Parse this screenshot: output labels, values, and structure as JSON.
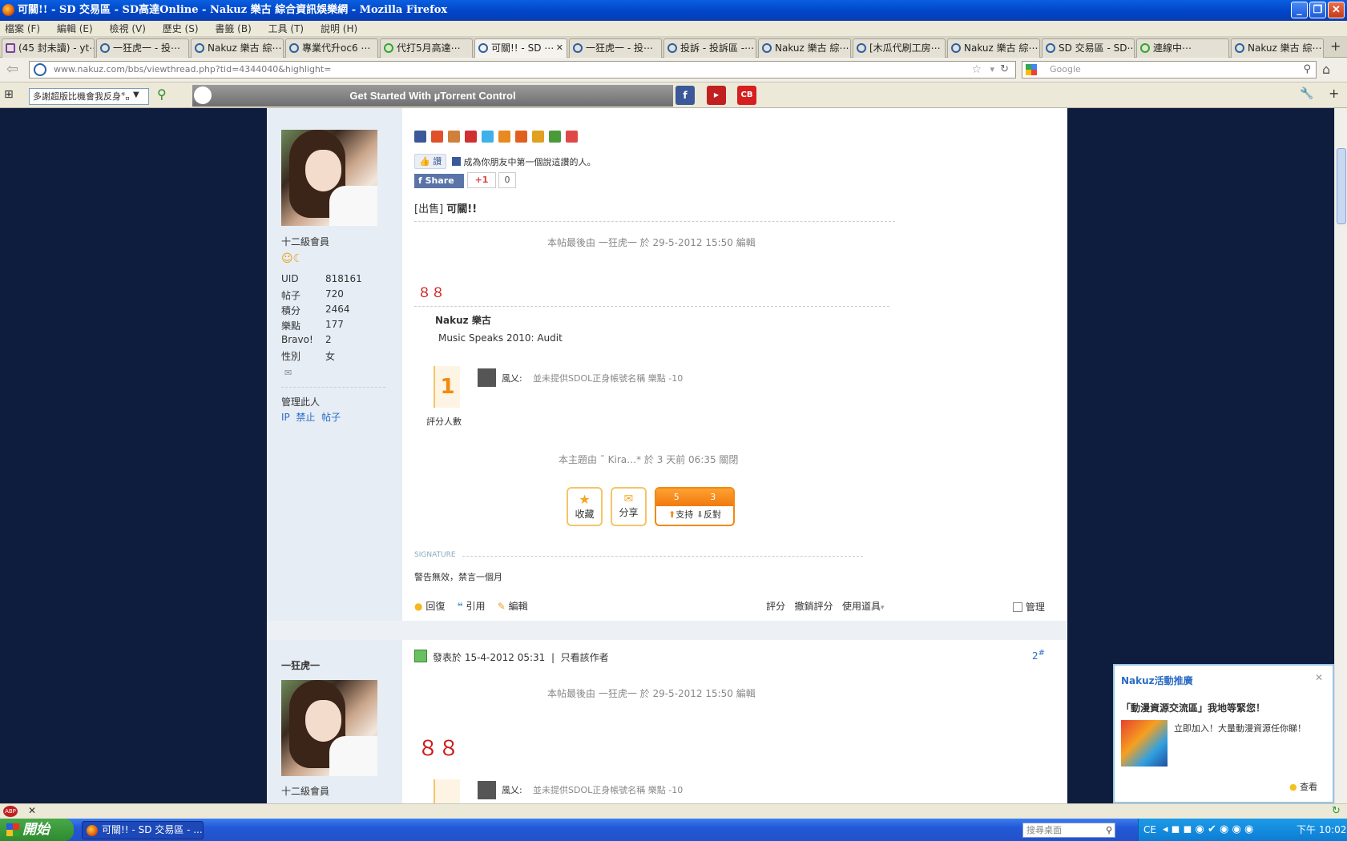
{
  "window": {
    "title": "可關!! - SD 交易區 - SD高達Online - Nakuz 樂古 綜合資訊娛樂網 - Mozilla Firefox"
  },
  "menu": [
    "檔案 (F)",
    "編輯 (E)",
    "檢視 (V)",
    "歷史 (S)",
    "書籤 (B)",
    "工具 (T)",
    "說明 (H)"
  ],
  "tabs": [
    "(45 封未讀) - yt⋯",
    "一狂虎一 - 投⋯",
    "Nakuz 樂古 綜⋯",
    "專業代升oc6 ⋯",
    "代打5月高達⋯",
    "可關!! - SD ⋯",
    "一狂虎一 - 投⋯",
    "投訴 - 投訴區 -⋯",
    "Nakuz 樂古 綜⋯",
    "[木瓜代刷工房⋯",
    "Nakuz 樂古 綜⋯",
    "SD 交易區 - SD⋯",
    "連線中⋯",
    "Nakuz 樂古 綜⋯"
  ],
  "url": "www.nakuz.com/bbs/viewthread.php?tid=4344040&highlight=",
  "search_placeholder": "Google",
  "toolbar": {
    "select_value": "多謝超版比機會我反身㌔",
    "utorrent": "Get Started With µTorrent Control"
  },
  "post1": {
    "rank": "十二級會員",
    "stats": [
      {
        "k": "UID",
        "v": "818161"
      },
      {
        "k": "帖子",
        "v": "720"
      },
      {
        "k": "積分",
        "v": "2464"
      },
      {
        "k": "樂點",
        "v": "177"
      },
      {
        "k": "Bravo!",
        "v": "2"
      },
      {
        "k": "性別",
        "v": "女"
      }
    ],
    "manage": "管理此人",
    "manage_links": [
      "IP",
      "禁止",
      "帖子"
    ],
    "like_btn": "讚",
    "like_text": "成為你朋友中第一個說這讚的人。",
    "share": "Share",
    "plus": "+1",
    "plus_count": "0",
    "tag": "[出售]",
    "title": "可關!!",
    "edited": "本帖最後由 一狂虎一 於 29-5-2012 15:50 編輯",
    "content": "８８",
    "rate_site": "Nakuz 樂古",
    "rate_event": "Music Speaks 2010: Audit",
    "rate_count": "1",
    "rate_label": "評分人數",
    "rater": "風乂:",
    "rate_reason": "並未提供SDOL正身帳號名稱 樂點 -10",
    "closed": "本主題由 ˜ Kira…* 於 3 天前 06:35 關閉",
    "fav": "收藏",
    "share_btn": "分享",
    "support_n": "5",
    "oppose_n": "3",
    "support": "支持",
    "oppose": "反對",
    "sig_label": "SIGNATURE",
    "signature": "警告無效，禁言一個月",
    "reply": "回復",
    "quote": "引用",
    "edit": "編輯",
    "rate": "評分",
    "unrate": "撤銷評分",
    "tools": "使用道具",
    "admin": "管理"
  },
  "post2": {
    "author": "一狂虎一",
    "posted": "發表於 15-4-2012 05:31",
    "only_author": "只看該作者",
    "floor": "2",
    "floor_sym": "#",
    "edited": "本帖最後由 一狂虎一 於 29-5-2012 15:50 編輯",
    "content": "８８",
    "rank": "十二級會員",
    "rater": "風乂:",
    "rate_reason": "並未提供SDOL正身帳號名稱 樂點 -10"
  },
  "popup": {
    "title": "Nakuz活動推廣",
    "headline": "「動漫資源交流區」我地等緊您！",
    "body": "立即加入！大量動漫資源任你睇！",
    "view": "查看"
  },
  "taskbar": {
    "start": "開始",
    "item": "可關!! - SD 交易區 - ...",
    "search": "搜尋桌面",
    "time": "下午 10:02",
    "lang": "CE"
  }
}
